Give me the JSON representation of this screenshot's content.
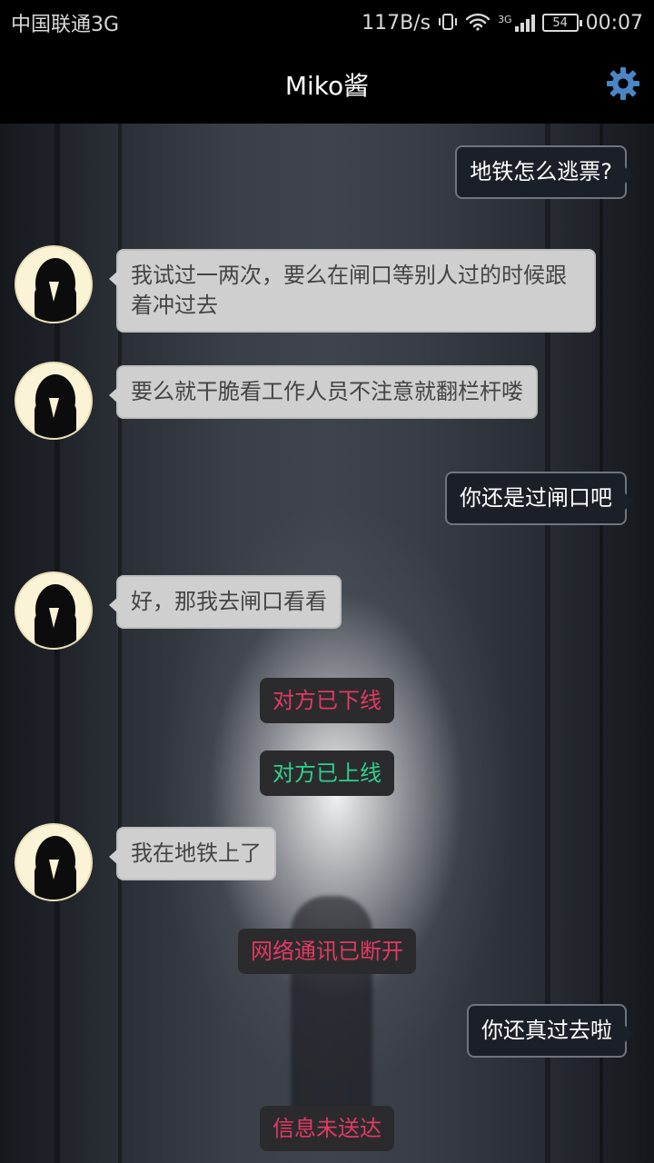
{
  "status_bar": {
    "carrier": "中国联通3G",
    "net_speed": "117B/s",
    "network_type": "3G",
    "battery": "54",
    "time": "00:07",
    "icons": [
      "vibrate-icon",
      "wifi-icon",
      "signal-icon",
      "battery-icon"
    ]
  },
  "header": {
    "title": "Miko酱",
    "settings_icon": "gear-icon",
    "accent_color": "#4a86c5"
  },
  "messages": [
    {
      "from": "me",
      "text": "地铁怎么逃票?"
    },
    {
      "from": "miko",
      "text": "我试过一两次，要么在闸口等别人过的时候跟着冲过去"
    },
    {
      "from": "miko",
      "text": "要么就干脆看工作人员不注意就翻栏杆喽"
    },
    {
      "from": "me",
      "text": "你还是过闸口吧"
    },
    {
      "from": "miko",
      "text": "好，那我去闸口看看"
    },
    {
      "from": "system",
      "text": "对方已下线",
      "color": "#e23a63"
    },
    {
      "from": "system",
      "text": "对方已上线",
      "color": "#2fd08d"
    },
    {
      "from": "miko",
      "text": "我在地铁上了"
    },
    {
      "from": "system",
      "text": "网络通讯已断开",
      "color": "#e23a63"
    },
    {
      "from": "me",
      "text": "你还真过去啦"
    },
    {
      "from": "system",
      "text": "信息未送达",
      "color": "#e23a63"
    }
  ]
}
